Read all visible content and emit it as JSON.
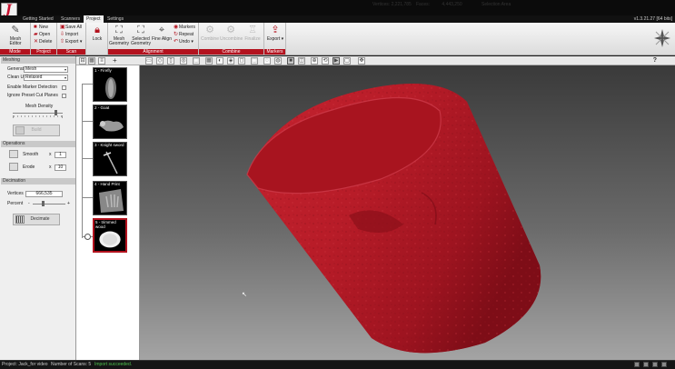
{
  "app": {
    "logo_letter": "J",
    "version": "v1.3.21.27 [64 bits]",
    "accent": "#b3121e"
  },
  "menu": {
    "tabs": [
      {
        "label": "Getting Started",
        "active": false
      },
      {
        "label": "Scanners",
        "active": false
      },
      {
        "label": "Project",
        "active": true
      },
      {
        "label": "Settings",
        "active": false
      }
    ]
  },
  "ribbon": {
    "groups": {
      "mode": "Mode",
      "project": "Project",
      "scan": "Scan",
      "alignment": "Alignment",
      "combine": "Combine",
      "markers": "Markers"
    },
    "mesh_editor": "Mesh Editor",
    "project_new": "New",
    "project_open": "Open",
    "project_delete": "Delete",
    "scan_save_all": "Save All",
    "scan_import": "Import",
    "scan_export": "Export",
    "lock": "Lock",
    "mesh_geometry": "Mesh\nGeometry",
    "selected_geometry": "Selected\nGeometry",
    "fine_align": "Fine Align",
    "align_markers": "Markers",
    "align_repeat": "Repeat",
    "align_undo": "Undo",
    "combine": "Combine",
    "uncombine": "Uncombine",
    "finalize": "Finalize",
    "markers_export": "Export"
  },
  "meshing": {
    "section": "Meshing",
    "geometry_label": "Generate",
    "geometry_value": "Mesh",
    "clean_up_label": "Clean Up",
    "clean_up_value": "Relaxed",
    "enable_marker_detection": "Enable Marker Detection",
    "ignore_preset_cut_planes": "Ignore Preset Cut Planes",
    "mesh_density_label": "Mesh Density",
    "mesh_density_level": 0.85,
    "build_button": "Build"
  },
  "operations": {
    "section": "Operations",
    "smooth_label": "Smooth",
    "smooth_value": "1",
    "erode_label": "Erode",
    "erode_value": "10",
    "multiplier": "x"
  },
  "decimation": {
    "section": "Decimation",
    "vertices_label": "Vertices",
    "vertices_value": "666,535",
    "percent_label": "Percent",
    "percent_level": 0.3,
    "minus": "-",
    "plus": "+",
    "decimate_button": "Decimate"
  },
  "toolbar": {
    "vertices_label": "Vertices:",
    "vertices_value": "2,221,785",
    "faces_label": "Faces:",
    "faces_value": "4,443,250",
    "selection_area": "Selection Area",
    "help": "?",
    "add_symbol": "+"
  },
  "scans": [
    {
      "label": "1 - Firefly",
      "selected": false
    },
    {
      "label": "2 - Goat",
      "selected": false
    },
    {
      "label": "3 - Knight sword",
      "selected": false
    },
    {
      "label": "4 - Hand Print",
      "selected": false
    },
    {
      "label": "5 - trimmed wood",
      "selected": true
    }
  ],
  "viewport": {
    "mesh_color": "#b01a2a"
  },
  "status": {
    "project_label": "Project:",
    "project_name": "Jack_for video",
    "scans_label": "Number of Scans:",
    "scans_count": "5",
    "message": "Import succeeded."
  }
}
